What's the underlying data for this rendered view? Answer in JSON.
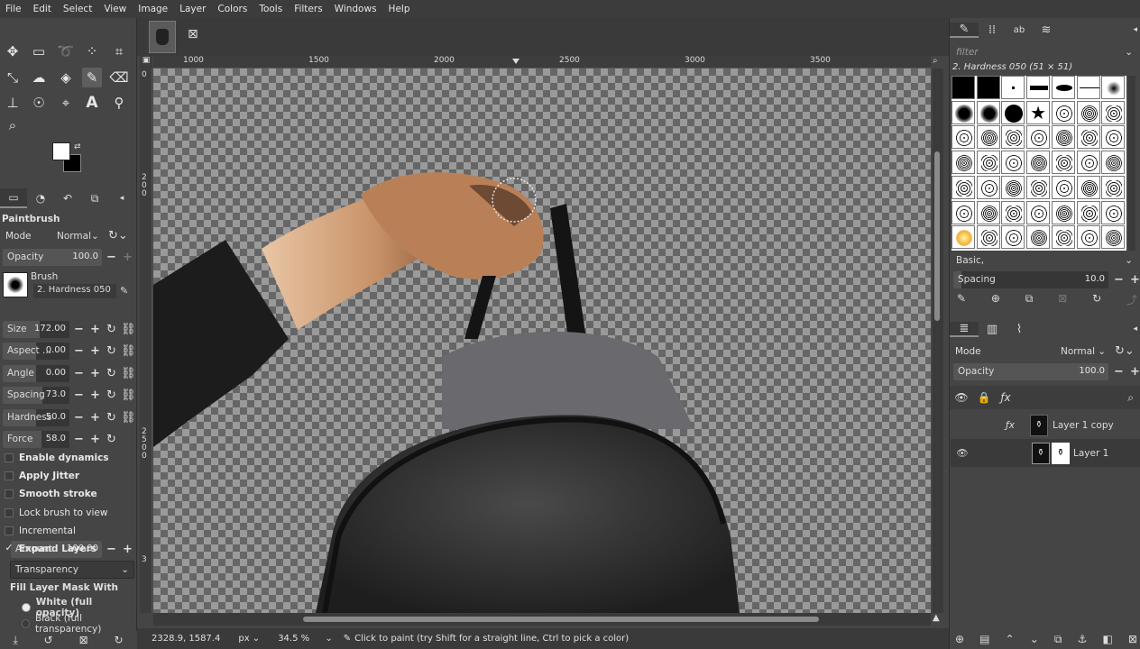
{
  "menu": [
    "File",
    "Edit",
    "Select",
    "View",
    "Image",
    "Layer",
    "Colors",
    "Tools",
    "Filters",
    "Windows",
    "Help"
  ],
  "tool_options": {
    "title": "Paintbrush",
    "mode_label": "Mode",
    "mode_value": "Normal",
    "opacity_label": "Opacity",
    "opacity_value": "100.0",
    "brush_label": "Brush",
    "brush_name": "2. Hardness 050",
    "sliders": [
      {
        "label": "Size",
        "value": "172.00",
        "fill": 0.55
      },
      {
        "label": "Aspect ...",
        "value": "0.00",
        "fill": 0.5
      },
      {
        "label": "Angle",
        "value": "0.00",
        "fill": 0.5
      },
      {
        "label": "Spacing",
        "value": "73.0",
        "fill": 0.6
      },
      {
        "label": "Hardness",
        "value": "50.0",
        "fill": 0.5
      },
      {
        "label": "Force",
        "value": "58.0",
        "fill": 0.58
      }
    ],
    "checks": [
      {
        "label": "Enable dynamics",
        "checked": false,
        "bold": true
      },
      {
        "label": "Apply Jitter",
        "checked": false,
        "bold": true
      },
      {
        "label": "Smooth stroke",
        "checked": false,
        "bold": true
      },
      {
        "label": "Lock brush to view",
        "checked": false,
        "bold": false
      },
      {
        "label": "Incremental",
        "checked": false,
        "bold": false
      },
      {
        "label": "Expand Layers",
        "checked": true,
        "bold": true
      }
    ],
    "amount_label": "Amount",
    "amount_value": "100.00",
    "fill_mode": "Transparency",
    "fill_mask_label": "Fill Layer Mask With",
    "radio_white": "White (full opacity)",
    "radio_black": "Black (full transparency)"
  },
  "rulers": {
    "h": [
      "1000",
      "1500",
      "2000",
      "2500",
      "3000",
      "3500"
    ],
    "v": [
      "0",
      "2",
      "0",
      "0",
      "2",
      "5",
      "0",
      "0",
      "3"
    ]
  },
  "status": {
    "coords": "2328.9, 1587.4",
    "unit": "px",
    "zoom": "34.5 %",
    "message": "Click to paint (try Shift for a straight line, Ctrl to pick a color)"
  },
  "brushes": {
    "filter_placeholder": "filter",
    "selected": "2. Hardness 050 (51 × 51)",
    "tag": "Basic,",
    "spacing_label": "Spacing",
    "spacing_value": "10.0"
  },
  "layers": {
    "mode_label": "Mode",
    "mode_value": "Normal",
    "opacity_label": "Opacity",
    "opacity_value": "100.0",
    "items": [
      {
        "name": "Layer 1 copy",
        "visible": false
      },
      {
        "name": "Layer 1",
        "visible": true
      }
    ]
  }
}
